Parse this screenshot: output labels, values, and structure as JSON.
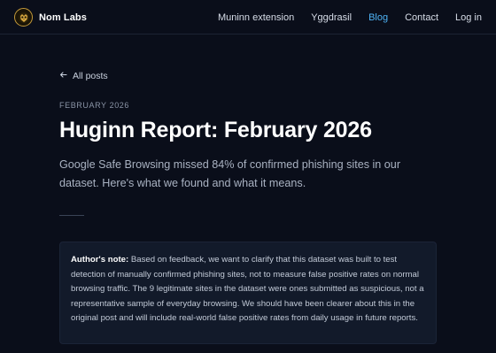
{
  "nav": {
    "brand": "Nom Labs",
    "logo_icon": "owl-logo-icon",
    "links": [
      {
        "label": "Muninn extension",
        "active": false
      },
      {
        "label": "Yggdrasil",
        "active": false
      },
      {
        "label": "Blog",
        "active": true
      },
      {
        "label": "Contact",
        "active": false
      },
      {
        "label": "Log in",
        "active": false
      }
    ],
    "active_color": "#4fb3f5"
  },
  "post": {
    "back_label": "All posts",
    "back_icon": "arrow-left-icon",
    "date": "FEBRUARY 2026",
    "title": "Huginn Report: February 2026",
    "lede": "Google Safe Browsing missed 84% of confirmed phishing sites in our dataset. Here's what we found and what it means.",
    "note_label": "Author's note:",
    "note_text": "Based on feedback, we want to clarify that this dataset was built to test detection of manually confirmed phishing sites, not to measure false positive rates on normal browsing traffic. The 9 legitimate sites in the dataset were ones submitted as suspicious, not a representative sample of everyday browsing. We should have been clearer about this in the original post and will include real-world false positive rates from daily usage in future reports."
  },
  "colors": {
    "background": "#0a0e1a",
    "note_background": "#121a2a",
    "logo_ring": "#c49a3a"
  }
}
